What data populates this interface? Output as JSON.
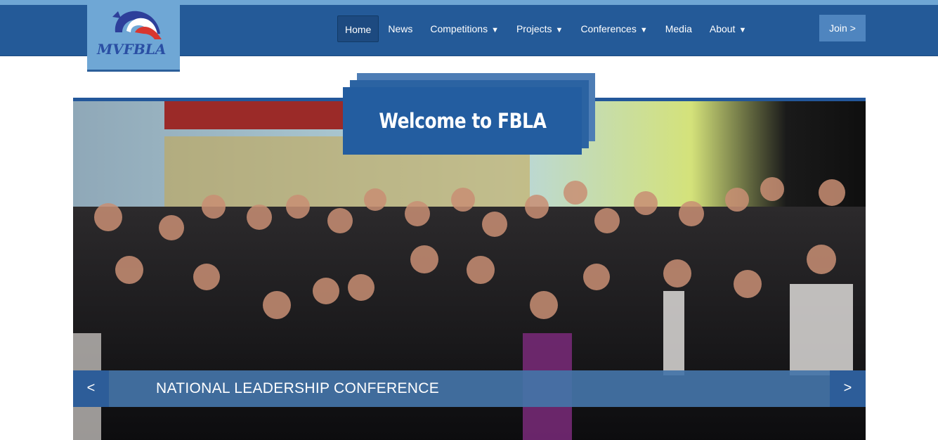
{
  "logo": {
    "text": "MVFBLA"
  },
  "nav": {
    "items": [
      {
        "label": "Home",
        "caret": ""
      },
      {
        "label": "News",
        "caret": ""
      },
      {
        "label": "Competitions",
        "caret": "▼"
      },
      {
        "label": "Projects",
        "caret": "▼"
      },
      {
        "label": "Conferences",
        "caret": "▼"
      },
      {
        "label": "Media",
        "caret": ""
      },
      {
        "label": "About",
        "caret": "▼"
      }
    ],
    "active": "Home",
    "join_label": "Join >"
  },
  "hero": {
    "welcome": "Welcome to FBLA",
    "caption": "NATIONAL LEADERSHIP CONFERENCE",
    "prev_label": "<",
    "next_label": ">"
  },
  "colors": {
    "navbar": "#245a98",
    "accent_light": "#6fa7d5",
    "caption_bar": "#4474a8",
    "join_button": "#4f85bf"
  }
}
